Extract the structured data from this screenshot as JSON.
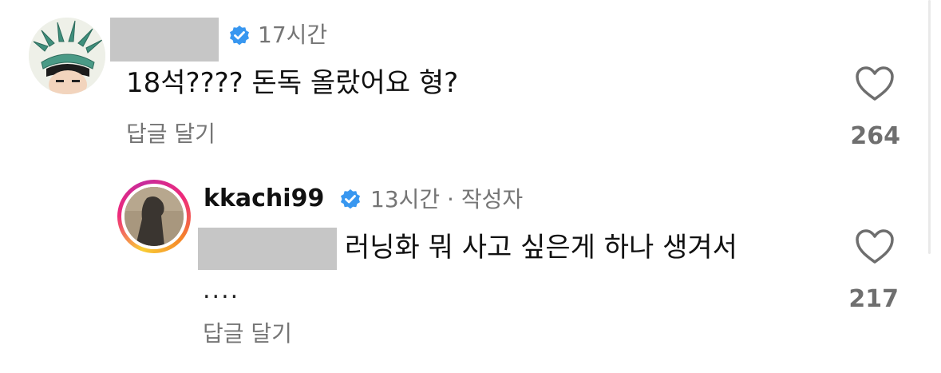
{
  "comment": {
    "time": "17시간",
    "text": "18석???? 돈독 올랐어요 형?",
    "reply_label": "답글 달기",
    "like_count": "264"
  },
  "reply": {
    "username": "kkachi99",
    "meta": "13시간 · 작성자",
    "text": "러닝화 뭐 사고 싶은게 하나 생겨서",
    "ellipsis": "....",
    "reply_label": "답글 달기",
    "like_count": "217"
  },
  "colors": {
    "verified_badge": "#3897f0",
    "secondary_text": "#757575",
    "redaction": "#c6c6c6"
  },
  "icons": {
    "verified": "verified-badge-icon",
    "like": "heart-outline-icon"
  }
}
